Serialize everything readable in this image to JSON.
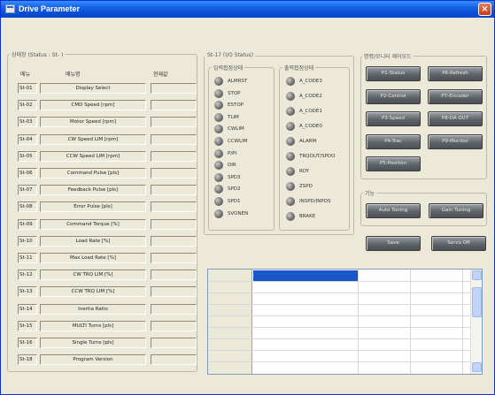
{
  "window": {
    "title": "Drive Parameter",
    "close": "×"
  },
  "status_group": {
    "title": "상태창 (Status : St- )",
    "headers": {
      "no": "메뉴",
      "name": "메뉴명",
      "value": "현재값"
    },
    "rows": [
      {
        "code": "St-01",
        "name": "Display Select"
      },
      {
        "code": "St-02",
        "name": "CMD Speed [rpm]"
      },
      {
        "code": "St-03",
        "name": "Motor Speed [rpm]"
      },
      {
        "code": "St-04",
        "name": "CW Speed LIM [rpm]"
      },
      {
        "code": "St-05",
        "name": "CCW Speed LIM [rpm]"
      },
      {
        "code": "St-06",
        "name": "Command Pulse [pls]"
      },
      {
        "code": "St-07",
        "name": "Feedback Pulse [pls]"
      },
      {
        "code": "St-08",
        "name": "Error Pulse [pls]"
      },
      {
        "code": "St-09",
        "name": "Command Torque [%]"
      },
      {
        "code": "St-10",
        "name": "Load Rate [%]"
      },
      {
        "code": "St-11",
        "name": "Max Load Rate [%]"
      },
      {
        "code": "St-12",
        "name": "CW TRQ LIM [%]"
      },
      {
        "code": "St-13",
        "name": "CCW TRQ LIM [%]"
      },
      {
        "code": "St-14",
        "name": "Inertia Ratio"
      },
      {
        "code": "St-15",
        "name": "MULTI Turns [pls]"
      },
      {
        "code": "St-16",
        "name": "Single Turns [pls]"
      },
      {
        "code": "St-18",
        "name": "Program Version"
      }
    ]
  },
  "io_group": {
    "title": "St-17 (I/O Status)",
    "input_title": "입력접점상태",
    "output_title": "출력접점상태",
    "inputs": [
      "ALMRST",
      "STOP",
      "ESTOP",
      "TLIM",
      "CWLIM",
      "CCWLIM",
      "P/PI",
      "DIR",
      "SPD3",
      "SPD2",
      "SPD1",
      "SVONEN"
    ],
    "outputs": [
      "A_CODE3",
      "A_CODE2",
      "A_CODE1",
      "A_CODE0",
      "ALARM",
      "TRQOUT/SPDO",
      "RDY",
      "ZSPD",
      "INSPD/INPOS",
      "BRAKE"
    ]
  },
  "menu_group": {
    "title": "명령/모니터 제어모드",
    "buttons_left": [
      "P1-Status",
      "P2-Control",
      "P3-Speed",
      "P4-Trac",
      "P5-Position"
    ],
    "buttons_right": [
      "P6-Refresh",
      "P7-Encoder",
      "P8-DA OUT",
      "P9-Monitor"
    ]
  },
  "tuning_group": {
    "title": "기능",
    "buttons": [
      "Auto Tuning",
      "Gain Tuning"
    ]
  },
  "actions": {
    "save": "Save",
    "servo_off": "Servo Off"
  }
}
